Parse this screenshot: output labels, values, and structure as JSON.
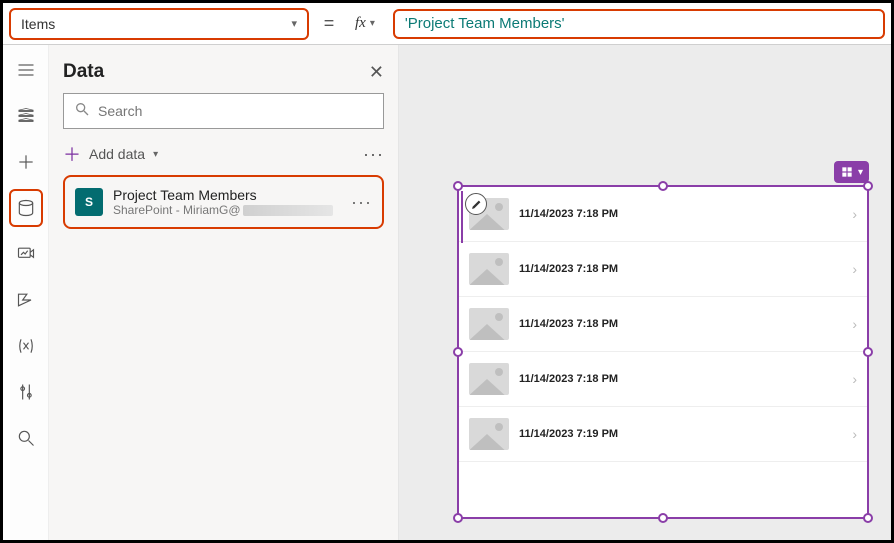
{
  "property_dropdown": {
    "value": "Items"
  },
  "formula_bar": {
    "equals": "=",
    "fx_label": "fx",
    "text": "'Project Team Members'"
  },
  "data_panel": {
    "title": "Data",
    "search_placeholder": "Search",
    "add_label": "Add data",
    "data_source": {
      "badge": "S",
      "name": "Project Team Members",
      "subtitle": "SharePoint - MiriamG@"
    }
  },
  "gallery": {
    "rows": [
      {
        "text": "11/14/2023 7:18 PM"
      },
      {
        "text": "11/14/2023 7:18 PM"
      },
      {
        "text": "11/14/2023 7:18 PM"
      },
      {
        "text": "11/14/2023 7:18 PM"
      },
      {
        "text": "11/14/2023 7:19 PM"
      }
    ]
  },
  "colors": {
    "accent": "#8a3ea8",
    "highlight": "#d83b01",
    "formula": "#0b7a75",
    "sp": "#036c70"
  }
}
